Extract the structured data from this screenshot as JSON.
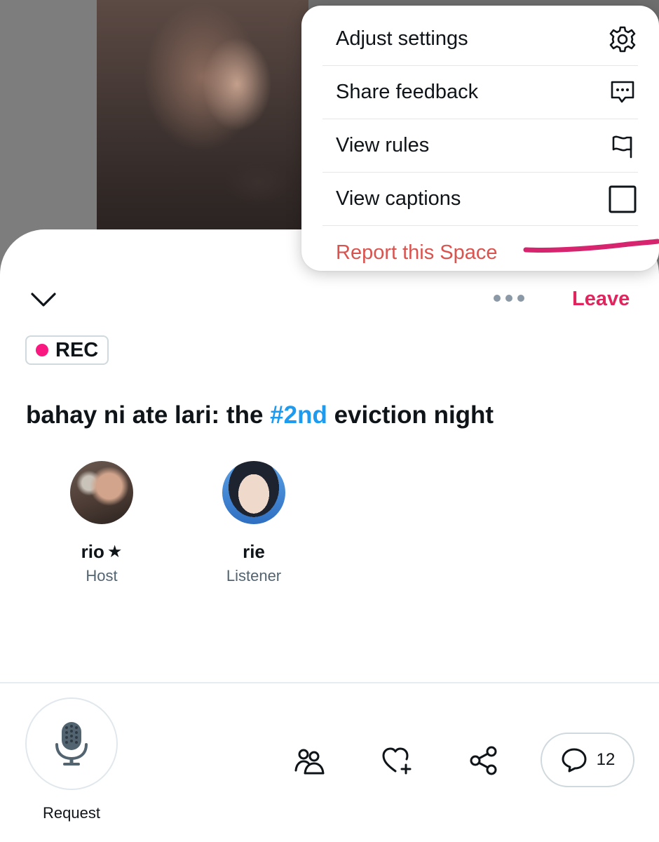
{
  "menu": {
    "items": [
      {
        "label": "Adjust settings",
        "icon": "gear-icon"
      },
      {
        "label": "Share feedback",
        "icon": "feedback-icon"
      },
      {
        "label": "View rules",
        "icon": "flag-icon"
      },
      {
        "label": "View captions",
        "icon": "checkbox-icon",
        "checked": false
      },
      {
        "label": "Report this Space",
        "icon": null,
        "highlight_color": "#d6246e"
      }
    ]
  },
  "header": {
    "leave_label": "Leave",
    "leave_color": "#e0245e"
  },
  "rec_badge": {
    "label": "REC",
    "dot_color": "#f91880"
  },
  "space": {
    "title_before": "bahay ni ate lari: the ",
    "title_hashtag": "#2nd",
    "title_after": " eviction night",
    "hashtag_color": "#1d9bf0"
  },
  "participants": [
    {
      "name": "rio",
      "badge": "★",
      "role": "Host"
    },
    {
      "name": "rie",
      "badge": "",
      "role": "Listener"
    }
  ],
  "bottom_bar": {
    "mic_label": "Request",
    "comments_count": "12",
    "icons": [
      "microphone-icon",
      "people-icon",
      "heart-plus-icon",
      "share-icon",
      "comment-icon"
    ]
  }
}
